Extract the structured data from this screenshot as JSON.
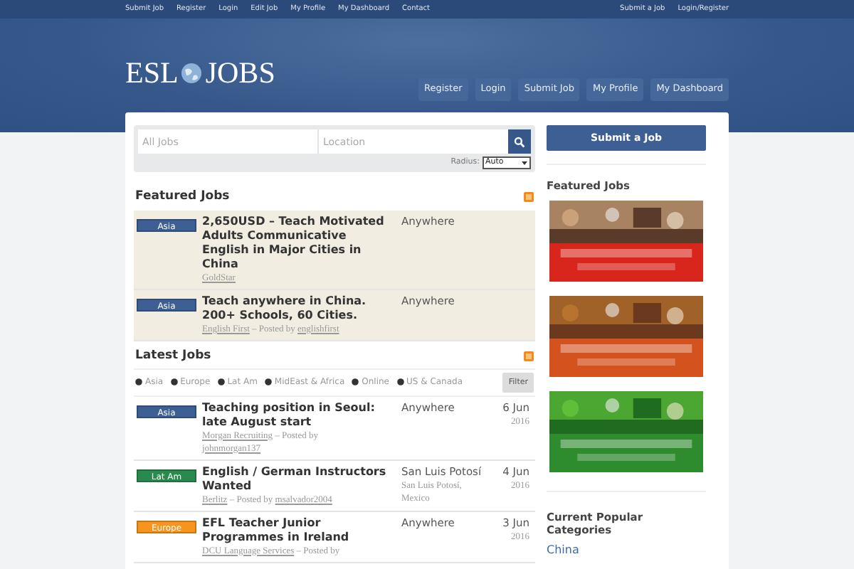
{
  "top_nav": {
    "left": [
      "Submit Job",
      "Register",
      "Login",
      "Edit Job",
      "My Profile",
      "My Dashboard",
      "Contact"
    ],
    "right": [
      "Submit a Job",
      "Login/Register"
    ]
  },
  "header": {
    "logo_left": "ESL",
    "logo_right": "JOBS",
    "nav": [
      "Register",
      "Login",
      "Submit Job",
      "My Profile",
      "My Dashboard"
    ]
  },
  "search": {
    "keyword_placeholder": "All Jobs",
    "location_placeholder": "Location",
    "radius_label": "Radius:",
    "radius_value": "Auto"
  },
  "featured": {
    "title": "Featured Jobs",
    "jobs": [
      {
        "tag": "Asia",
        "color": "#3d5f94",
        "title": "2,650USD – Teach Motivated Adults Communicative English in Major Cities in China",
        "location": "Anywhere",
        "company": "GoldStar"
      },
      {
        "tag": "Asia",
        "color": "#3d5f94",
        "title": "Teach anywhere in China. 200+ Schools, 60 Cities.",
        "location": "Anywhere",
        "company": "English First",
        "posted_label": "– Posted by",
        "posted_by": "englishfirst"
      }
    ]
  },
  "latest": {
    "title": "Latest Jobs",
    "filters": [
      {
        "label": "Asia",
        "checked": true
      },
      {
        "label": "Europe",
        "checked": true
      },
      {
        "label": "Lat Am",
        "checked": true
      },
      {
        "label": "MidEast & Africa",
        "checked": true
      },
      {
        "label": "Online",
        "checked": true
      },
      {
        "label": "US & Canada",
        "checked": true
      }
    ],
    "filter_button": "Filter",
    "jobs": [
      {
        "tag": "Asia",
        "color": "#3d5f94",
        "title": "Teaching position in Seoul: late August start",
        "location": "Anywhere",
        "company": "Morgan Recruiting",
        "posted_label": "– Posted by",
        "posted_by": "johnmorgan137",
        "day": "6 Jun",
        "year": "2016"
      },
      {
        "tag": "Lat Am",
        "color": "#2a8a4e",
        "title": "English / German Instructors Wanted",
        "location": "San Luis Potosí",
        "location_detail": "San Luis Potosí, Mexico",
        "company": "Berlitz",
        "posted_label": "– Posted by",
        "posted_by": "msalvador2004",
        "day": "4 Jun",
        "year": "2016"
      },
      {
        "tag": "Europe",
        "color": "#f7941d",
        "title": "EFL Teacher Junior Programmes in Ireland",
        "location": "Anywhere",
        "company": "DCU Language Services",
        "posted_label": "– Posted by",
        "day": "3 Jun",
        "year": "2016"
      }
    ]
  },
  "sidebar": {
    "submit_button": "Submit a Job",
    "featured_title": "Featured Jobs",
    "banners": [
      {
        "kind": "picture"
      },
      {
        "kind": "picture"
      },
      {
        "kind": "picture"
      }
    ],
    "categories_title": "Current Popular Categories",
    "categories": [
      "China"
    ]
  }
}
